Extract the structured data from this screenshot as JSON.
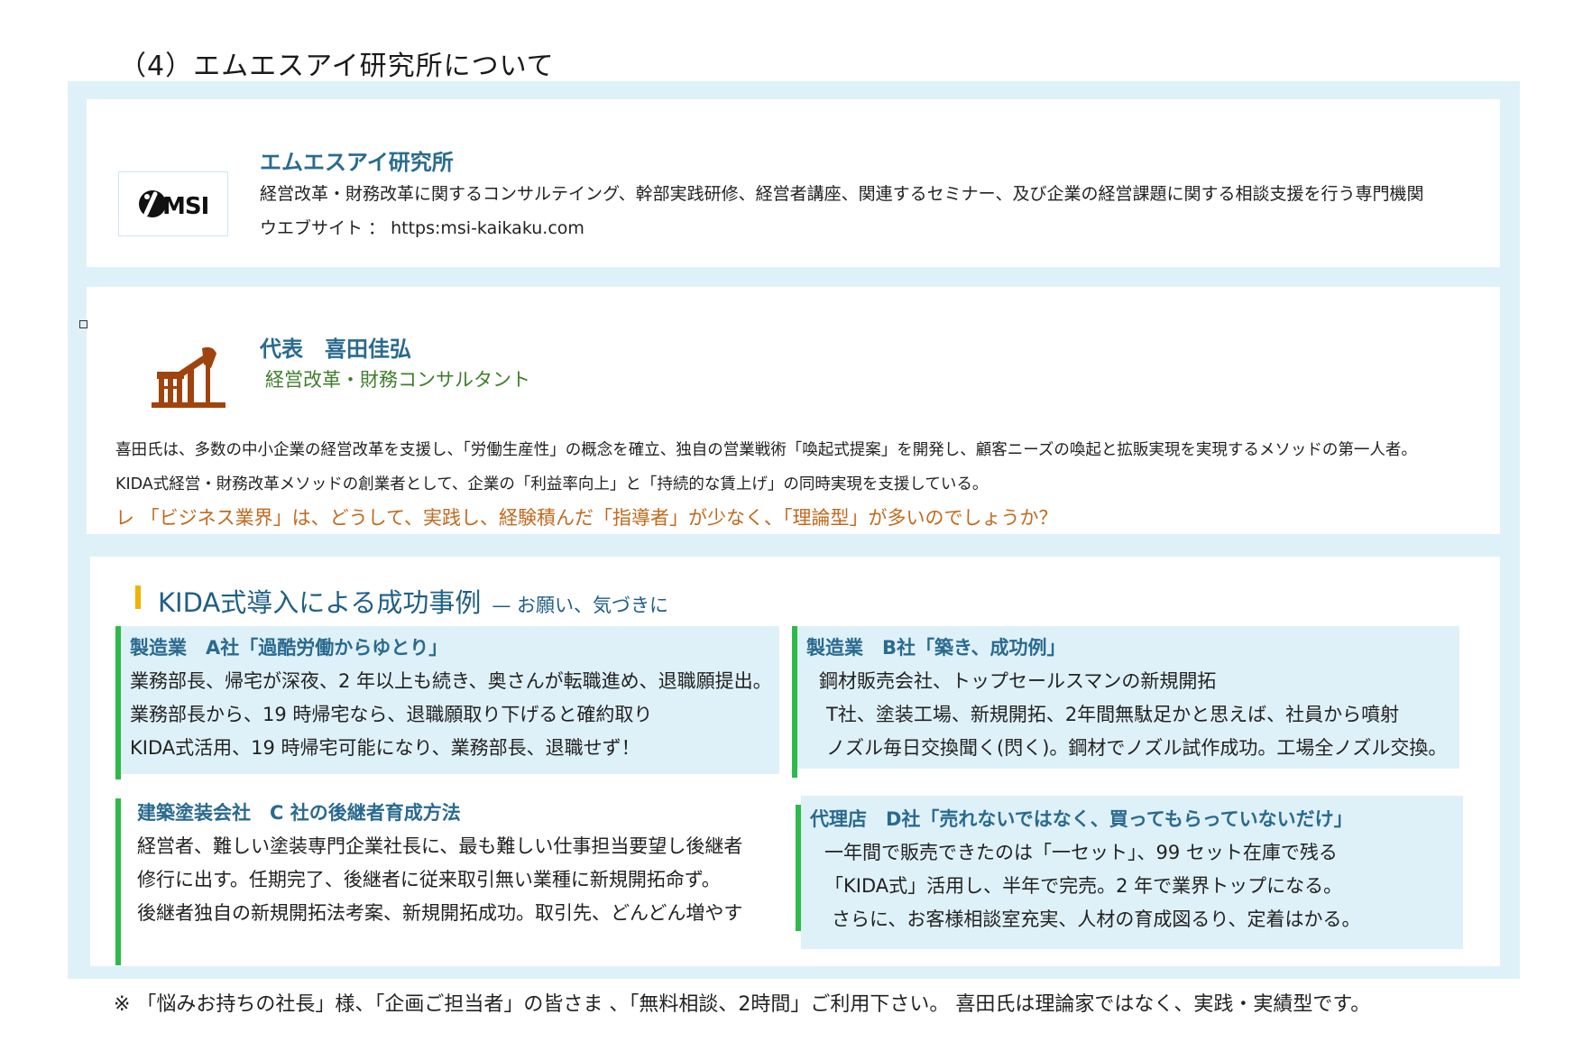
{
  "section_title": "（4）エムエスアイ研究所について",
  "org": {
    "logo_text": "MSI",
    "name": "エムエスアイ研究所",
    "description": "経営改革・財務改革に関するコンサルテイング、幹部実践研修、経営者講座、関連するセミナー、及び企業の経営課題に関する相談支援を行う専門機関",
    "website": "ウエブサイト ： https:msi-kaikaku.com"
  },
  "representative": {
    "name": "代表　喜田佳弘",
    "title": "経営改革・財務コンサルタント",
    "bio_line1": "喜田氏は、多数の中小企業の経営改革を支援し、「労働生産性」の概念を確立、独自の営業戦術「喚起式提案」を開発し、顧客ニーズの喚起と拡販実現を実現するメソッドの第一人者。",
    "bio_line2": "KIDA式経営・財務改革メソッドの創業者として、企業の「利益率向上」と「持続的な賃上げ」の同時実現を支援している。",
    "question": "レ 「ビジネス業界」は、どうして、実践し、経験積んだ「指導者」が少なく、「理論型」が多いのでしょうか？"
  },
  "cases": {
    "heading": "KIDA式導入による成功事例",
    "subheading": "—  お願い、気づきに",
    "a": {
      "title": "製造業　A社「過酷労働からゆとり」",
      "lines": [
        "業務部長、帰宅が深夜、2 年以上も続き、奥さんが転職進め、退職願提出。",
        "業務部長から、19 時帰宅なら、退職願取り下げると確約取り",
        "KIDA式活用、19 時帰宅可能になり、業務部長、退職せず！"
      ]
    },
    "b": {
      "title": "製造業　B社「築き、成功例」",
      "lines": [
        "鋼材販売会社、トップセールスマンの新規開拓",
        "T社、塗装工場、新規開拓、2年間無駄足かと思えば、社員から噴射",
        "ノズル毎日交換聞く(閃く)。鋼材でノズル試作成功。工場全ノズル交換。"
      ]
    },
    "c": {
      "title": "建築塗装会社　C 社の後継者育成方法",
      "lines": [
        "経営者、難しい塗装専門企業社長に、最も難しい仕事担当要望し後継者",
        "修行に出す。任期完了、後継者に従来取引無い業種に新規開拓命ず。",
        "後継者独自の新規開拓法考案、新規開拓成功。取引先、どんどん増やす"
      ]
    },
    "d": {
      "title": "代理店　D社「売れないではなく、買ってもらっていないだけ」",
      "lines": [
        "一年間で販売できたのは「一セット」、99 セット在庫で残る",
        "「KIDA式」活用し、半年で完売。2 年で業界トップになる。",
        "さらに、お客様相談室充実、人材の育成図るり、定着はかる。"
      ]
    }
  },
  "footer_note": "※ 「悩みお持ちの社長」様、「企画ご担当者」の皆さま 、「無料相談、2時間」ご利用下さい。 喜田氏は理論家ではなく、実践・実績型です。",
  "colors": {
    "frame_bg": "#dff1f8",
    "heading_blue": "#2a6a8f",
    "accent_green": "#2dba4a",
    "accent_yellow": "#f0b400",
    "question_orange": "#c06a1e",
    "pump_brown": "#a0440f"
  },
  "icons": [
    "msi-logo-icon",
    "oil-pump-icon"
  ]
}
